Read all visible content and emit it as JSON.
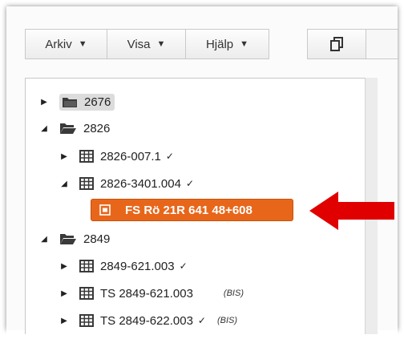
{
  "toolbar": {
    "arkiv": "Arkiv",
    "visa": "Visa",
    "hjalp": "Hjälp",
    "caret": "▼"
  },
  "tree": {
    "items": [
      {
        "label": "2676",
        "state": "collapsed",
        "icon": "folder-icon",
        "selected": true
      },
      {
        "label": "2826",
        "state": "expanded",
        "icon": "folder-open-icon"
      },
      {
        "label": "2826-007.1",
        "state": "collapsed",
        "icon": "grid-icon",
        "check": "✓"
      },
      {
        "label": "2826-3401.004",
        "state": "expanded",
        "icon": "grid-icon",
        "check": "✓"
      },
      {
        "label": "FS Rö 21R 641 48+608",
        "state": "leaf",
        "icon": "document-icon",
        "highlighted": true
      },
      {
        "label": "2849",
        "state": "expanded",
        "icon": "folder-open-icon"
      },
      {
        "label": "2849-621.003",
        "state": "collapsed",
        "icon": "grid-icon",
        "check": "✓"
      },
      {
        "label": "TS 2849-621.003",
        "state": "collapsed",
        "icon": "grid-icon",
        "badge": "(BIS)"
      },
      {
        "label": "TS 2849-622.003",
        "state": "collapsed",
        "icon": "grid-icon",
        "check": "✓",
        "badge": "(BIS)"
      }
    ],
    "toggle_collapsed": "▶",
    "toggle_expanded": "◢"
  },
  "colors": {
    "highlight": "#e8661a",
    "arrow": "#e00000"
  }
}
